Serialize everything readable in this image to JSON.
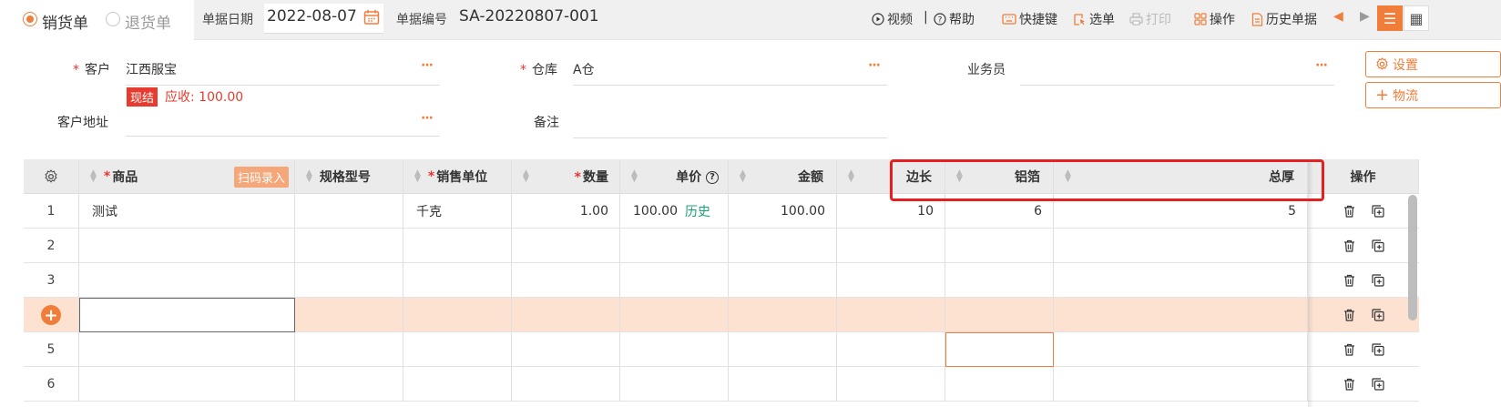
{
  "header": {
    "tabs": [
      {
        "label": "销货单",
        "active": true
      },
      {
        "label": "退货单",
        "active": false
      }
    ],
    "date_label": "单据日期",
    "date_value": "2022-08-07",
    "number_label": "单据编号",
    "number_value": "SA-20220807-001",
    "tools": {
      "video": "视频",
      "separator": "|",
      "help": "帮助",
      "shortcut": "快捷键",
      "select": "选单",
      "print": "打印",
      "operate": "操作",
      "history": "历史单据"
    }
  },
  "form": {
    "customer_label": "客户",
    "customer_value": "江西服宝",
    "warehouse_label": "仓库",
    "warehouse_value": "A仓",
    "salesman_label": "业务员",
    "salesman_value": "",
    "cash_badge": "现结",
    "receivable_text": "应收: 100.00",
    "address_label": "客户地址",
    "address_value": "",
    "remark_label": "备注",
    "remark_value": "",
    "required_mark": "*",
    "more_dots": "···",
    "settings_button": "设置",
    "logistics_button": "物流"
  },
  "table": {
    "columns": {
      "product": "商品",
      "scan_button": "扫码录入",
      "spec": "规格型号",
      "unit": "销售单位",
      "qty": "数量",
      "price": "单价",
      "amount": "金额",
      "edge": "边长",
      "foil": "铝箔",
      "thickness": "总厚",
      "op": "操作"
    },
    "rows": [
      {
        "no": "1",
        "product": "测试",
        "spec": "",
        "unit": "千克",
        "qty": "1.00",
        "price": "100.00",
        "price_link": "历史",
        "amount": "100.00",
        "blank": "",
        "edge": "10",
        "foil": "6",
        "thickness": "5"
      },
      {
        "no": "2",
        "product": "",
        "spec": "",
        "unit": "",
        "qty": "",
        "price": "",
        "price_link": "",
        "amount": "",
        "blank": "",
        "edge": "",
        "foil": "",
        "thickness": ""
      },
      {
        "no": "3",
        "product": "",
        "spec": "",
        "unit": "",
        "qty": "",
        "price": "",
        "price_link": "",
        "amount": "",
        "blank": "",
        "edge": "",
        "foil": "",
        "thickness": ""
      },
      {
        "no": "",
        "product": "",
        "spec": "",
        "unit": "",
        "qty": "",
        "price": "",
        "price_link": "",
        "amount": "",
        "blank": "",
        "edge": "",
        "foil": "",
        "thickness": ""
      },
      {
        "no": "5",
        "product": "",
        "spec": "",
        "unit": "",
        "qty": "",
        "price": "",
        "price_link": "",
        "amount": "",
        "blank": "",
        "edge": "",
        "foil": "",
        "thickness": ""
      },
      {
        "no": "6",
        "product": "",
        "spec": "",
        "unit": "",
        "qty": "",
        "price": "",
        "price_link": "",
        "amount": "",
        "blank": "",
        "edge": "",
        "foil": "",
        "thickness": ""
      }
    ]
  },
  "colors": {
    "accent": "#f07d3a",
    "highlight_row": "#fde2d2",
    "annotation_box": "#e62020",
    "link": "#1aa37a",
    "alert": "#e63b2e"
  }
}
